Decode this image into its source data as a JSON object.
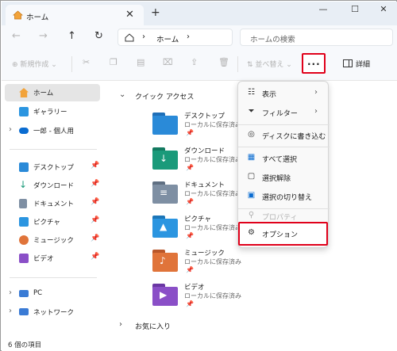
{
  "window": {
    "tab_title": "ホーム",
    "tab_close": "✕",
    "tab_add": "+",
    "minimize": "—",
    "maximize": "☐",
    "close": "✕"
  },
  "nav": {
    "back": "←",
    "forward": "→",
    "up": "↑",
    "refresh": "↻",
    "breadcrumb": "ホーム",
    "search_placeholder": "ホームの検索"
  },
  "commandbar": {
    "new_label": "新規作成",
    "sort_label": "並べ替え",
    "more_label": "···",
    "details_label": "詳細"
  },
  "sidebar": {
    "top_items": [
      {
        "label": "ホーム",
        "icon": "home-icon",
        "selected": true
      },
      {
        "label": "ギャラリー",
        "icon": "gallery-icon"
      },
      {
        "label": "一郎 - 個人用",
        "icon": "onedrive-icon"
      }
    ],
    "pinned_items": [
      {
        "label": "デスクトップ",
        "icon": "desktop-folder-icon"
      },
      {
        "label": "ダウンロード",
        "icon": "download-icon"
      },
      {
        "label": "ドキュメント",
        "icon": "documents-icon"
      },
      {
        "label": "ピクチャ",
        "icon": "pictures-icon"
      },
      {
        "label": "ミュージック",
        "icon": "music-icon"
      },
      {
        "label": "ビデオ",
        "icon": "videos-icon"
      }
    ],
    "bottom_items": [
      {
        "label": "PC",
        "icon": "pc-icon"
      },
      {
        "label": "ネットワーク",
        "icon": "network-icon"
      }
    ]
  },
  "main": {
    "quick_access_title": "クイック アクセス",
    "favorites_title": "お気に入り",
    "folders": [
      {
        "name": "デスクトップ",
        "sub": "ローカルに保存済み",
        "color": "#2a8ad8"
      },
      {
        "name": "ダウンロード",
        "sub": "ローカルに保存済み",
        "color": "#1a9a7a"
      },
      {
        "name": "ドキュメント",
        "sub": "ローカルに保存済み",
        "color": "#7e8fa3"
      },
      {
        "name": "ピクチャ",
        "sub": "ローカルに保存済み",
        "color": "#2b95e0"
      },
      {
        "name": "ミュージック",
        "sub": "ローカルに保存済み",
        "color": "#e0743a"
      },
      {
        "name": "ビデオ",
        "sub": "ローカルに保存済み",
        "color": "#8a4fc7"
      }
    ]
  },
  "menu": {
    "items": [
      {
        "label": "表示",
        "icon": "view-icon",
        "submenu": true
      },
      {
        "label": "フィルター",
        "icon": "filter-icon",
        "submenu": true
      },
      {
        "label": "ディスクに書き込む",
        "icon": "burn-disc-icon"
      },
      {
        "label": "すべて選択",
        "icon": "select-all-icon"
      },
      {
        "label": "選択解除",
        "icon": "select-none-icon"
      },
      {
        "label": "選択の切り替え",
        "icon": "invert-selection-icon"
      },
      {
        "label": "プロパティ",
        "icon": "properties-icon",
        "disabled": true
      },
      {
        "label": "オプション",
        "icon": "options-gear-icon"
      }
    ]
  },
  "status": {
    "item_count": "6 個の項目"
  },
  "colors": {
    "highlight": "#e0001a",
    "accent": "#0a6cd1"
  }
}
